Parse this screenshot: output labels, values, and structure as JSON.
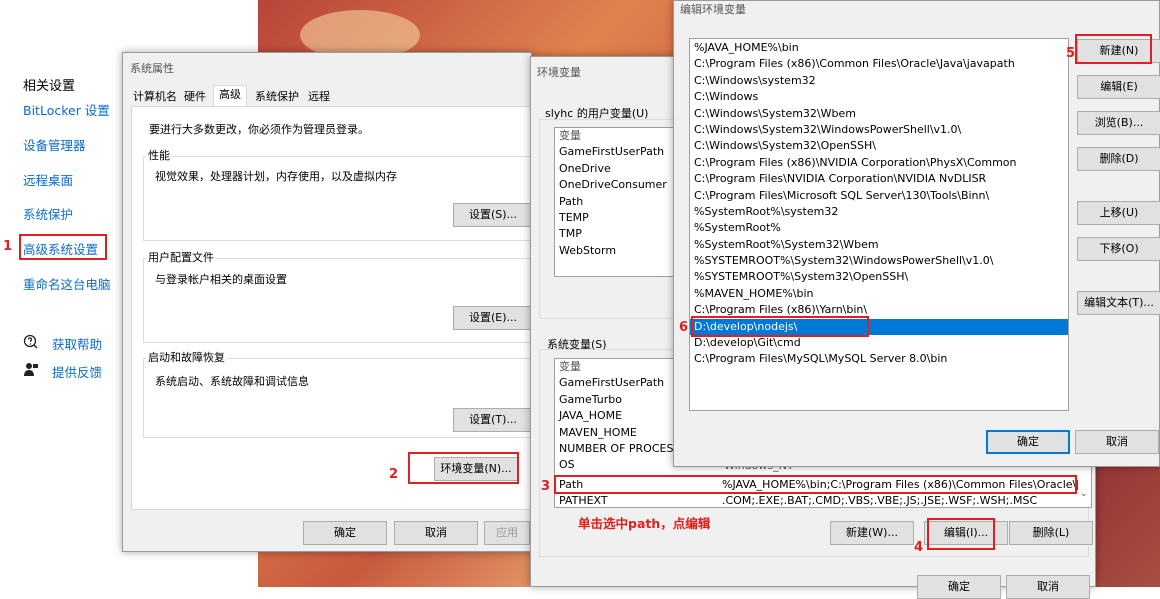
{
  "settings_panel": {
    "heading": "相关设置",
    "links": [
      "BitLocker 设置",
      "设备管理器",
      "远程桌面",
      "系统保护",
      "高级系统设置",
      "重命名这台电脑"
    ],
    "help": "获取帮助",
    "feedback": "提供反馈"
  },
  "sysprops": {
    "title": "系统属性",
    "tabs": [
      "计算机名",
      "硬件",
      "高级",
      "系统保护",
      "远程"
    ],
    "admin_note": "要进行大多数更改，你必须作为管理员登录。",
    "perf_label": "性能",
    "perf_desc": "视觉效果，处理器计划，内存使用，以及虚拟内存",
    "perf_btn": "设置(S)...",
    "profile_label": "用户配置文件",
    "profile_desc": "与登录帐户相关的桌面设置",
    "profile_btn": "设置(E)...",
    "startup_label": "启动和故障恢复",
    "startup_desc": "系统启动、系统故障和调试信息",
    "startup_btn": "设置(T)...",
    "env_btn": "环境变量(N)...",
    "ok": "确定",
    "cancel": "取消",
    "apply": "应用"
  },
  "envvars": {
    "title": "环境变量",
    "user_group": "slyhc 的用户变量(U)",
    "user_header": "变量",
    "user_vars": [
      "GameFirstUserPath",
      "OneDrive",
      "OneDriveConsumer",
      "Path",
      "TEMP",
      "TMP",
      "WebStorm"
    ],
    "sys_group": "系统变量(S)",
    "sys_header": "变量",
    "sys_vars": [
      "GameFirstUserPath",
      "GameTurbo",
      "JAVA_HOME",
      "MAVEN_HOME",
      "NUMBER OF PROCESS",
      "OS"
    ],
    "os_value": "Windows_NT",
    "path_name": "Path",
    "path_value": "%JAVA_HOME%\\bin;C:\\Program Files (x86)\\Common Files\\Oracle\\J...",
    "pathext_name": "PATHEXT",
    "pathext_value": ".COM;.EXE;.BAT;.CMD;.VBS;.VBE;.JS;.JSE;.WSF;.WSH;.MSC",
    "new_btn": "新建(W)...",
    "edit_btn": "编辑(I)...",
    "delete_btn": "删除(L)",
    "ok": "确定",
    "cancel": "取消"
  },
  "editenv": {
    "title": "编辑环境变量",
    "entries": [
      "%JAVA_HOME%\\bin",
      "C:\\Program Files (x86)\\Common Files\\Oracle\\Java\\javapath",
      "C:\\Windows\\system32",
      "C:\\Windows",
      "C:\\Windows\\System32\\Wbem",
      "C:\\Windows\\System32\\WindowsPowerShell\\v1.0\\",
      "C:\\Windows\\System32\\OpenSSH\\",
      "C:\\Program Files (x86)\\NVIDIA Corporation\\PhysX\\Common",
      "C:\\Program Files\\NVIDIA Corporation\\NVIDIA NvDLISR",
      "C:\\Program Files\\Microsoft SQL Server\\130\\Tools\\Binn\\",
      "%SystemRoot%\\system32",
      "%SystemRoot%",
      "%SystemRoot%\\System32\\Wbem",
      "%SYSTEMROOT%\\System32\\WindowsPowerShell\\v1.0\\",
      "%SYSTEMROOT%\\System32\\OpenSSH\\",
      "%MAVEN_HOME%\\bin",
      "C:\\Program Files (x86)\\Yarn\\bin\\",
      "D:\\develop\\nodejs\\",
      "D:\\develop\\Git\\cmd",
      "C:\\Program Files\\MySQL\\MySQL Server 8.0\\bin"
    ],
    "selected_index": 17,
    "new": "新建(N)",
    "edit": "编辑(E)",
    "browse": "浏览(B)...",
    "delete": "删除(D)",
    "up": "上移(U)",
    "down": "下移(O)",
    "edit_text": "编辑文本(T)...",
    "ok": "确定",
    "cancel": "取消"
  },
  "annotations": {
    "n1": "1",
    "n2": "2",
    "n3": "3",
    "n4": "4",
    "n5": "5",
    "n6": "6",
    "hint": "单击选中path，点编辑",
    "color": "#e02020"
  }
}
